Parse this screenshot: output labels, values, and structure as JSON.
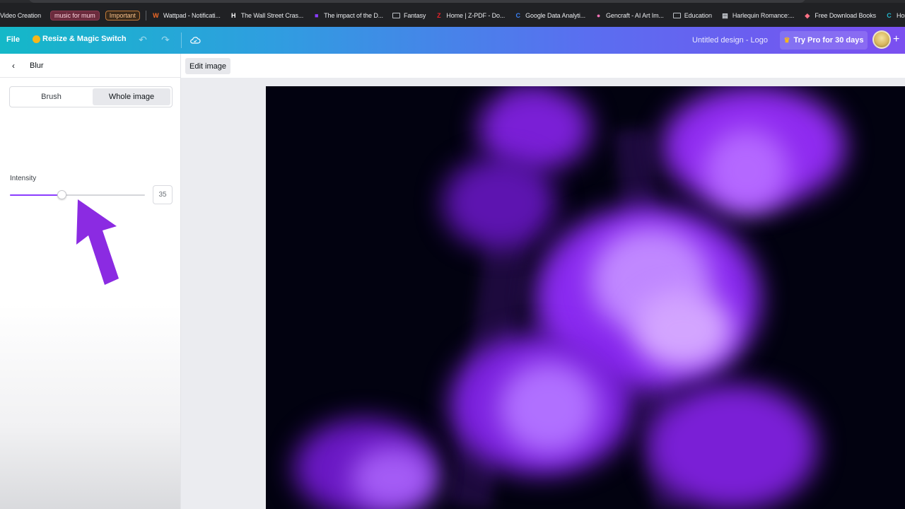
{
  "bookmarks": {
    "items": [
      {
        "label": "Video Creation",
        "type": "text"
      },
      {
        "label": "music for mum",
        "type": "chip-pink"
      },
      {
        "label": "Important",
        "type": "chip-orange"
      },
      {
        "label": "Wattpad - Notificati...",
        "type": "site",
        "icon": "W",
        "color": "#f26a26"
      },
      {
        "label": "The Wall Street Cras...",
        "type": "site",
        "icon": "H",
        "color": "#ffffff"
      },
      {
        "label": "The impact of the D...",
        "type": "site",
        "icon": "■",
        "color": "#8b3dff"
      },
      {
        "label": "Fantasy",
        "type": "folder"
      },
      {
        "label": "Home | Z-PDF - Do...",
        "type": "site",
        "icon": "Z",
        "color": "#e8222a"
      },
      {
        "label": "Google Data Analyti...",
        "type": "site",
        "icon": "C",
        "color": "#3b82f6"
      },
      {
        "label": "Gencraft - AI Art Im...",
        "type": "site",
        "icon": "●",
        "color": "#f472b6"
      },
      {
        "label": "Education",
        "type": "folder"
      },
      {
        "label": "Harlequin Romance:...",
        "type": "site",
        "icon": "▤",
        "color": "#d1d5db"
      },
      {
        "label": "Free Download Books",
        "type": "site",
        "icon": "◆",
        "color": "#fb7185"
      },
      {
        "label": "Home - Canva",
        "type": "site",
        "icon": "C",
        "color": "#22b8cf"
      }
    ]
  },
  "header": {
    "file_label": "File",
    "resize_label": "Resize & Magic Switch",
    "undo_icon": "undo-icon",
    "redo_icon": "redo-icon",
    "cloud_icon": "cloud-sync-icon",
    "design_title": "Untitled design - Logo",
    "try_pro_label": "Try Pro for 30 days",
    "plus_label": "+"
  },
  "panel": {
    "back_icon": "chevron-left-icon",
    "title": "Blur",
    "segment": {
      "options": [
        "Brush",
        "Whole image"
      ],
      "selected": "Whole image"
    },
    "intensity": {
      "label": "Intensity",
      "value": "35",
      "fraction": 0.35
    }
  },
  "canvas": {
    "edit_image_label": "Edit image",
    "accent": "#8b3dff"
  }
}
